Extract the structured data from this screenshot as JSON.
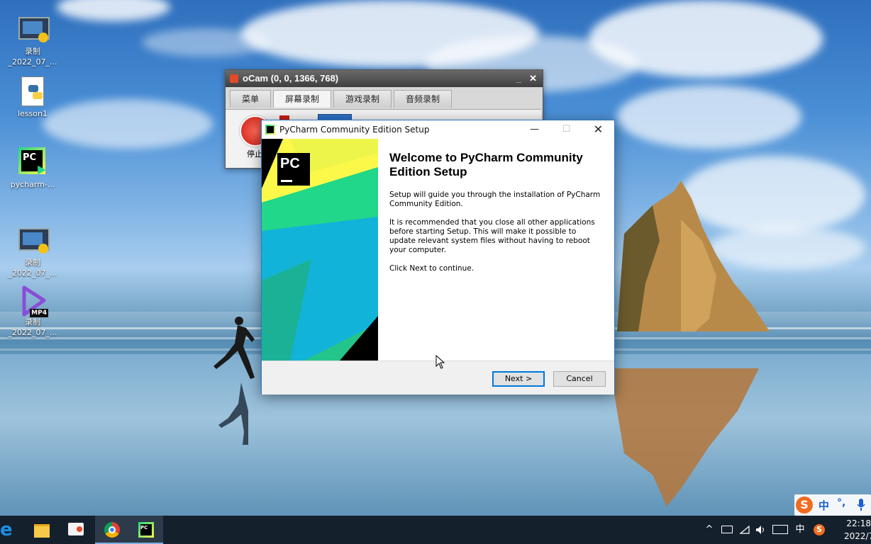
{
  "desktop": {
    "icons": [
      {
        "label_line1": "录制",
        "label_line2": "_2022_07_...",
        "icon": "video-recording-icon"
      },
      {
        "label": "lesson1",
        "icon": "python-file-icon"
      },
      {
        "label": "pycharm-...",
        "icon": "pycharm-icon"
      },
      {
        "label_line1": "录制",
        "label_line2": "_2022_07_...",
        "icon": "video-recording-icon"
      },
      {
        "label_line1": "录制",
        "label_line2": "_2022_07_...",
        "icon": "mp4-file-icon",
        "badge": "MP4"
      }
    ]
  },
  "ocam": {
    "title": "oCam (0, 0, 1366, 768)",
    "tabs": [
      "菜单",
      "屏幕录制",
      "游戏录制",
      "音频录制"
    ],
    "active_tab": "屏幕录制",
    "stop_label": "停止"
  },
  "setup": {
    "title": "PyCharm Community Edition Setup",
    "logo_text": "PC",
    "heading": "Welcome to PyCharm Community Edition Setup",
    "para1": "Setup will guide you through the installation of PyCharm Community Edition.",
    "para2": "It is recommended that you close all other applications before starting Setup. This will make it possible to update relevant system files without having to reboot your computer.",
    "para3": "Click Next to continue.",
    "next_label": "Next >",
    "cancel_label": "Cancel"
  },
  "ime_bar": {
    "lang": "中",
    "punct": "°,"
  },
  "taskbar": {
    "apps": [
      "edge-icon",
      "file-explorer-icon",
      "ocam-icon",
      "chrome-icon",
      "pycharm-icon"
    ],
    "tray": {
      "ime": "中"
    },
    "time": "22:18",
    "date": "2022/7/"
  },
  "colors": {
    "taskbar": "#15202d",
    "accent": "#0078d7",
    "pycharm_green": "#24c58b"
  }
}
